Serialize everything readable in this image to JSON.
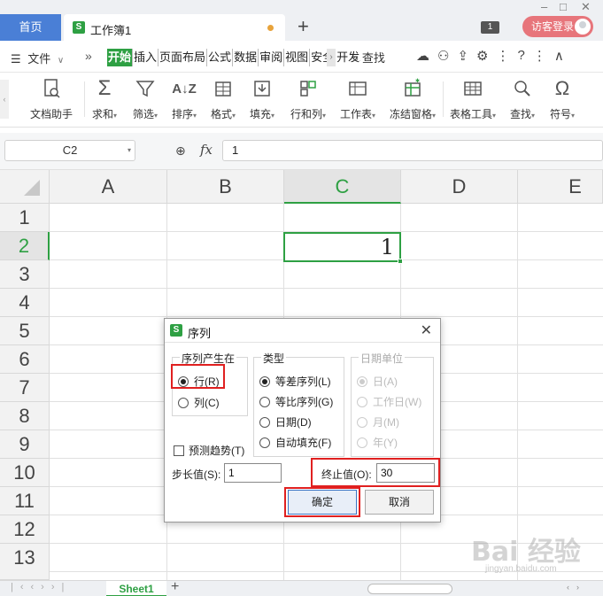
{
  "titlebar": {
    "home_tab": "首页",
    "doc_icon": "S",
    "doc_name": "工作簿1",
    "add_tab": "+",
    "window_count": "1",
    "login_label": "访客登录"
  },
  "menubar": {
    "file_label": "文件",
    "tabs": [
      "开始",
      "插入",
      "页面布局",
      "公式",
      "数据",
      "审阅",
      "视图",
      "安全",
      "开发工"
    ],
    "search_label": "查找"
  },
  "ribbon": {
    "items": [
      {
        "label": "文档助手",
        "icon": "doc-assistant-icon"
      },
      {
        "label": "求和",
        "icon": "sum-icon"
      },
      {
        "label": "筛选",
        "icon": "filter-icon"
      },
      {
        "label": "排序",
        "icon": "sort-icon"
      },
      {
        "label": "格式",
        "icon": "format-icon"
      },
      {
        "label": "填充",
        "icon": "fill-icon"
      },
      {
        "label": "行和列",
        "icon": "rows-cols-icon"
      },
      {
        "label": "工作表",
        "icon": "worksheet-icon"
      },
      {
        "label": "冻结窗格",
        "icon": "freeze-panes-icon"
      },
      {
        "label": "表格工具",
        "icon": "table-tools-icon"
      },
      {
        "label": "查找",
        "icon": "find-icon"
      },
      {
        "label": "符号",
        "icon": "symbol-icon"
      }
    ]
  },
  "formula_bar": {
    "cell_ref": "C2",
    "fx": "fx",
    "value": "1"
  },
  "grid": {
    "columns": [
      "A",
      "B",
      "C",
      "D",
      "E"
    ],
    "rows": [
      "1",
      "2",
      "3",
      "4",
      "5",
      "6",
      "7",
      "8",
      "9",
      "10",
      "11",
      "12",
      "13"
    ],
    "selected_column": "C",
    "selected_row": "2",
    "active_cell_value": "1"
  },
  "sheets": {
    "tabs": [
      "Sheet1"
    ],
    "add": "+"
  },
  "dialog": {
    "title": "序列",
    "icon": "S",
    "close": "✕",
    "group_series_in": {
      "label": "序列产生在",
      "options": [
        "行(R)",
        "列(C)"
      ],
      "selected": "行(R)"
    },
    "group_type": {
      "label": "类型",
      "options": [
        "等差序列(L)",
        "等比序列(G)",
        "日期(D)",
        "自动填充(F)"
      ],
      "selected": "等差序列(L)"
    },
    "group_date_unit": {
      "label": "日期单位",
      "options": [
        "日(A)",
        "工作日(W)",
        "月(M)",
        "年(Y)"
      ],
      "selected": "日(A)",
      "disabled": true
    },
    "trend_label": "预测趋势(T)",
    "trend_checked": false,
    "step_label": "步长值(S):",
    "step_value": "1",
    "stop_label": "终止值(O):",
    "stop_value": "30",
    "ok_label": "确定",
    "cancel_label": "取消"
  },
  "watermark": {
    "text": "Bai 经验",
    "sub": "jingyan.baidu.com"
  },
  "colors": {
    "accent_green": "#2ea043",
    "home_blue": "#4a7fd6",
    "highlight_red": "#e02020",
    "login_pink": "#e7757b"
  }
}
